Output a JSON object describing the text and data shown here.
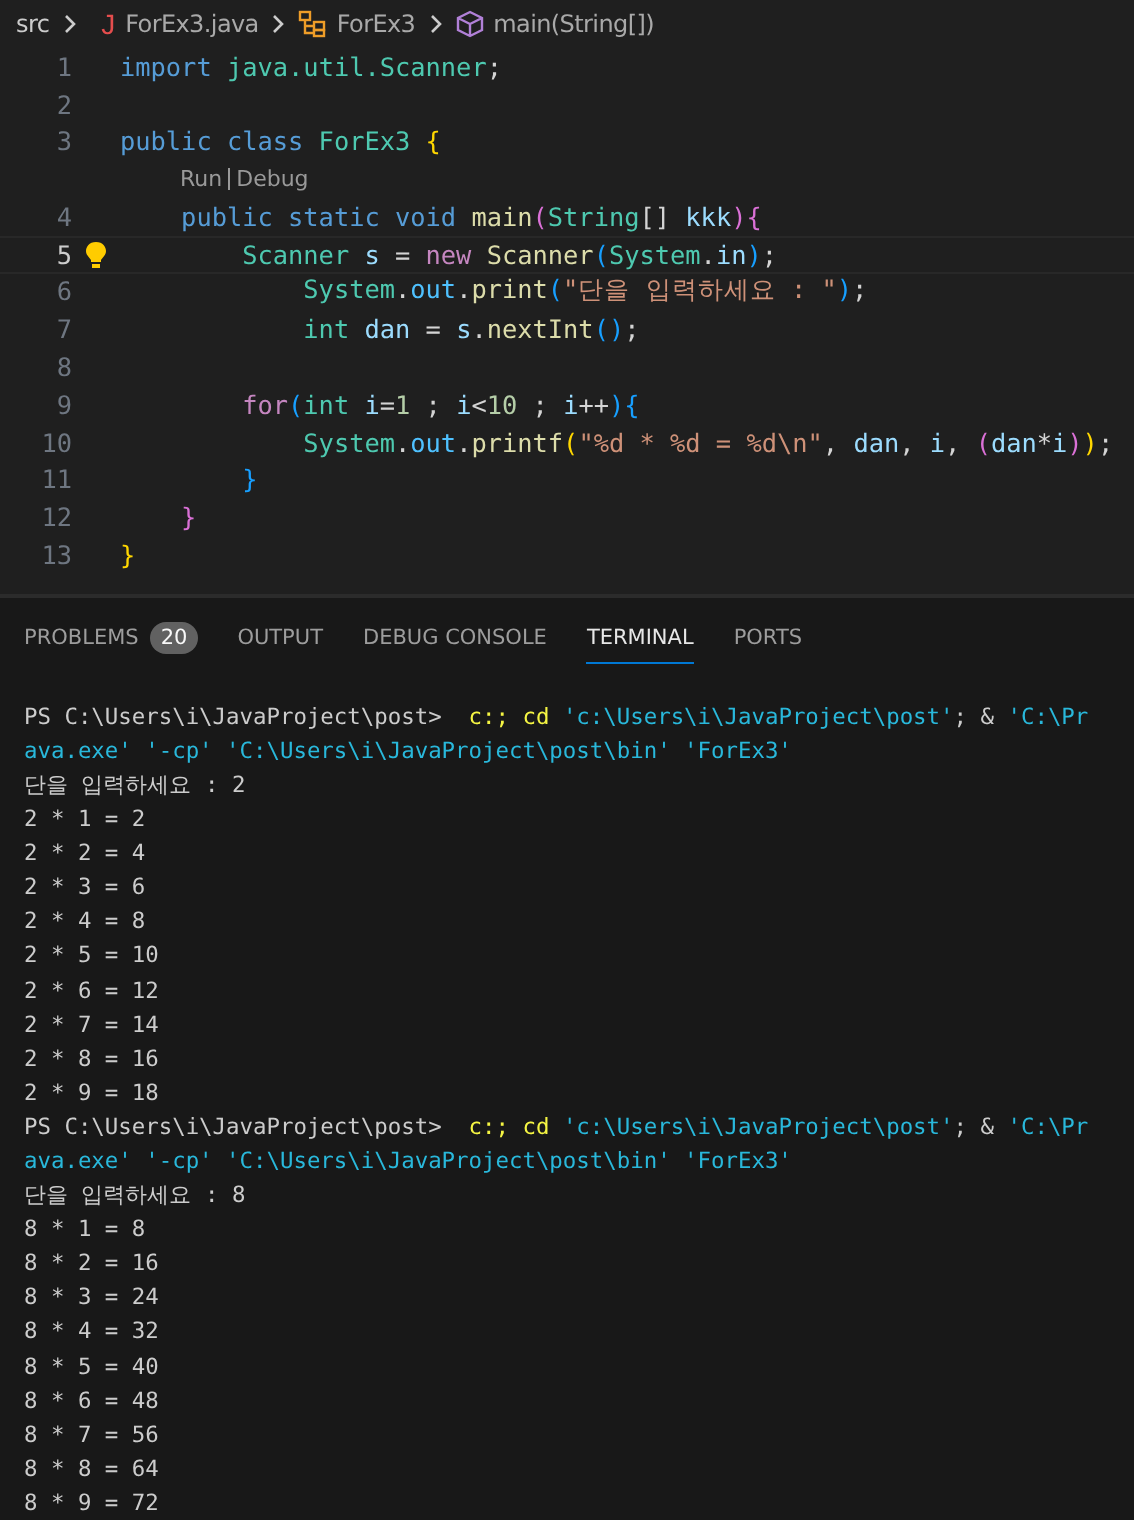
{
  "breadcrumb": [
    {
      "label": "src",
      "kind": "folder"
    },
    {
      "label": "ForEx3.java",
      "kind": "java-file",
      "icon_text": "J"
    },
    {
      "label": "ForEx3",
      "kind": "class"
    },
    {
      "label": "main(String[])",
      "kind": "method"
    }
  ],
  "editor": {
    "lines": [
      {
        "number": "1",
        "current": false,
        "tokens": [
          {
            "text": "import",
            "kind": "keyword"
          },
          {
            "text": " java.util.Scanner",
            "kind": "type"
          },
          {
            "text": ";",
            "kind": "plain"
          }
        ]
      },
      {
        "number": "2",
        "current": false
      },
      {
        "number": "3",
        "current": false,
        "tokens": [
          {
            "text": "public class",
            "kind": "keyword"
          },
          {
            "text": " ForEx3 ",
            "kind": "type"
          },
          {
            "text": "{",
            "kind": "bracket1"
          }
        ]
      },
      {
        "kind": "codelens",
        "links": [
          "Run",
          "Debug"
        ]
      },
      {
        "number": "4",
        "current": false,
        "tokens": [
          {
            "text": "    public static void",
            "kind": "keyword"
          },
          {
            "text": " main",
            "kind": "function"
          },
          {
            "text": "(",
            "kind": "bracket2"
          },
          {
            "text": "String",
            "kind": "type"
          },
          {
            "text": "[]",
            "kind": "plain"
          },
          {
            "text": " kkk",
            "kind": "variable"
          },
          {
            "text": ")",
            "kind": "bracket2"
          },
          {
            "text": "{",
            "kind": "bracket2"
          }
        ]
      },
      {
        "number": "5",
        "current": true,
        "lightbulb": true,
        "tokens": [
          {
            "text": "        Scanner",
            "kind": "type"
          },
          {
            "text": " s",
            "kind": "variable"
          },
          {
            "text": " = ",
            "kind": "plain"
          },
          {
            "text": "new",
            "kind": "control"
          },
          {
            "text": " Scanner",
            "kind": "function"
          },
          {
            "text": "(",
            "kind": "bracket3"
          },
          {
            "text": "System",
            "kind": "type"
          },
          {
            "text": ".",
            "kind": "plain"
          },
          {
            "text": "in",
            "kind": "variable"
          },
          {
            "text": ")",
            "kind": "bracket3"
          },
          {
            "text": ";",
            "kind": "plain"
          }
        ]
      },
      {
        "number": "6",
        "current": false,
        "tokens": [
          {
            "text": "            System",
            "kind": "type"
          },
          {
            "text": ".",
            "kind": "plain"
          },
          {
            "text": "out",
            "kind": "field"
          },
          {
            "text": ".",
            "kind": "plain"
          },
          {
            "text": "print",
            "kind": "function"
          },
          {
            "text": "(",
            "kind": "bracket3"
          },
          {
            "text": "\"단을 입력하세요 : \"",
            "kind": "string"
          },
          {
            "text": ")",
            "kind": "bracket3"
          },
          {
            "text": ";",
            "kind": "plain"
          }
        ]
      },
      {
        "number": "7",
        "current": false,
        "tokens": [
          {
            "text": "            int",
            "kind": "type"
          },
          {
            "text": " dan",
            "kind": "variable"
          },
          {
            "text": " = ",
            "kind": "plain"
          },
          {
            "text": "s",
            "kind": "variable"
          },
          {
            "text": ".",
            "kind": "plain"
          },
          {
            "text": "nextInt",
            "kind": "function"
          },
          {
            "text": "()",
            "kind": "bracket3"
          },
          {
            "text": ";",
            "kind": "plain"
          }
        ]
      },
      {
        "number": "8",
        "current": false
      },
      {
        "number": "9",
        "current": false,
        "tokens": [
          {
            "text": "        for",
            "kind": "control"
          },
          {
            "text": "(",
            "kind": "bracket3"
          },
          {
            "text": "int",
            "kind": "type"
          },
          {
            "text": " i",
            "kind": "variable"
          },
          {
            "text": "=",
            "kind": "plain"
          },
          {
            "text": "1",
            "kind": "number"
          },
          {
            "text": " ; ",
            "kind": "plain"
          },
          {
            "text": "i",
            "kind": "variable"
          },
          {
            "text": "<",
            "kind": "plain"
          },
          {
            "text": "10",
            "kind": "number"
          },
          {
            "text": " ; ",
            "kind": "plain"
          },
          {
            "text": "i",
            "kind": "variable"
          },
          {
            "text": "++",
            "kind": "plain"
          },
          {
            "text": ")",
            "kind": "bracket3"
          },
          {
            "text": "{",
            "kind": "bracket3"
          }
        ]
      },
      {
        "number": "10",
        "current": false,
        "tokens": [
          {
            "text": "            System",
            "kind": "type"
          },
          {
            "text": ".",
            "kind": "plain"
          },
          {
            "text": "out",
            "kind": "field"
          },
          {
            "text": ".",
            "kind": "plain"
          },
          {
            "text": "printf",
            "kind": "function"
          },
          {
            "text": "(",
            "kind": "bracket1"
          },
          {
            "text": "\"%d * %d = %d\\n\"",
            "kind": "string"
          },
          {
            "text": ", ",
            "kind": "plain"
          },
          {
            "text": "dan",
            "kind": "variable"
          },
          {
            "text": ", ",
            "kind": "plain"
          },
          {
            "text": "i",
            "kind": "variable"
          },
          {
            "text": ", ",
            "kind": "plain"
          },
          {
            "text": "(",
            "kind": "bracket2"
          },
          {
            "text": "dan",
            "kind": "variable"
          },
          {
            "text": "*",
            "kind": "plain"
          },
          {
            "text": "i",
            "kind": "variable"
          },
          {
            "text": ")",
            "kind": "bracket2"
          },
          {
            "text": ")",
            "kind": "bracket1"
          },
          {
            "text": ";",
            "kind": "plain"
          }
        ]
      },
      {
        "number": "11",
        "current": false,
        "tokens": [
          {
            "text": "        }",
            "kind": "bracket3"
          }
        ]
      },
      {
        "number": "12",
        "current": false,
        "tokens": [
          {
            "text": "    }",
            "kind": "bracket2"
          }
        ]
      },
      {
        "number": "13",
        "current": false,
        "tokens": [
          {
            "text": "}",
            "kind": "bracket1"
          }
        ]
      }
    ]
  },
  "panel": {
    "tabs": [
      {
        "label": "PROBLEMS",
        "badge": "20",
        "selected": false
      },
      {
        "label": "OUTPUT",
        "selected": false
      },
      {
        "label": "DEBUG CONSOLE",
        "selected": false
      },
      {
        "label": "TERMINAL",
        "selected": true
      },
      {
        "label": "PORTS",
        "selected": false
      }
    ]
  },
  "terminal": {
    "lines": [
      [
        {
          "text": "PS C:\\Users\\i\\JavaProject\\post>  ",
          "kind": "plain"
        },
        {
          "text": "c:; cd",
          "kind": "command"
        },
        {
          "text": " 'c:\\Users\\i\\JavaProject\\post'",
          "kind": "string"
        },
        {
          "text": "; & ",
          "kind": "plain"
        },
        {
          "text": "'C:\\Pr",
          "kind": "string"
        }
      ],
      [
        {
          "text": "ava.exe' '-cp' 'C:\\Users\\i\\JavaProject\\post\\bin' 'ForEx3'",
          "kind": "string"
        }
      ],
      [
        {
          "text": "단을 입력하세요 : 2",
          "kind": "plain"
        }
      ],
      [
        {
          "text": "2 * 1 = 2",
          "kind": "plain"
        }
      ],
      [
        {
          "text": "2 * 2 = 4",
          "kind": "plain"
        }
      ],
      [
        {
          "text": "2 * 3 = 6",
          "kind": "plain"
        }
      ],
      [
        {
          "text": "2 * 4 = 8",
          "kind": "plain"
        }
      ],
      [
        {
          "text": "2 * 5 = 10",
          "kind": "plain"
        }
      ],
      [
        {
          "text": "2 * 6 = 12",
          "kind": "plain"
        }
      ],
      [
        {
          "text": "2 * 7 = 14",
          "kind": "plain"
        }
      ],
      [
        {
          "text": "2 * 8 = 16",
          "kind": "plain"
        }
      ],
      [
        {
          "text": "2 * 9 = 18",
          "kind": "plain"
        }
      ],
      [
        {
          "text": "PS C:\\Users\\i\\JavaProject\\post>  ",
          "kind": "plain"
        },
        {
          "text": "c:; cd",
          "kind": "command"
        },
        {
          "text": " 'c:\\Users\\i\\JavaProject\\post'",
          "kind": "string"
        },
        {
          "text": "; & ",
          "kind": "plain"
        },
        {
          "text": "'C:\\Pr",
          "kind": "string"
        }
      ],
      [
        {
          "text": "ava.exe' '-cp' 'C:\\Users\\i\\JavaProject\\post\\bin' 'ForEx3'",
          "kind": "string"
        }
      ],
      [
        {
          "text": "단을 입력하세요 : 8",
          "kind": "plain"
        }
      ],
      [
        {
          "text": "8 * 1 = 8",
          "kind": "plain"
        }
      ],
      [
        {
          "text": "8 * 2 = 16",
          "kind": "plain"
        }
      ],
      [
        {
          "text": "8 * 3 = 24",
          "kind": "plain"
        }
      ],
      [
        {
          "text": "8 * 4 = 32",
          "kind": "plain"
        }
      ],
      [
        {
          "text": "8 * 5 = 40",
          "kind": "plain"
        }
      ],
      [
        {
          "text": "8 * 6 = 48",
          "kind": "plain"
        }
      ],
      [
        {
          "text": "8 * 7 = 56",
          "kind": "plain"
        }
      ],
      [
        {
          "text": "8 * 8 = 64",
          "kind": "plain"
        }
      ],
      [
        {
          "text": "8 * 9 = 72",
          "kind": "plain"
        }
      ]
    ]
  }
}
